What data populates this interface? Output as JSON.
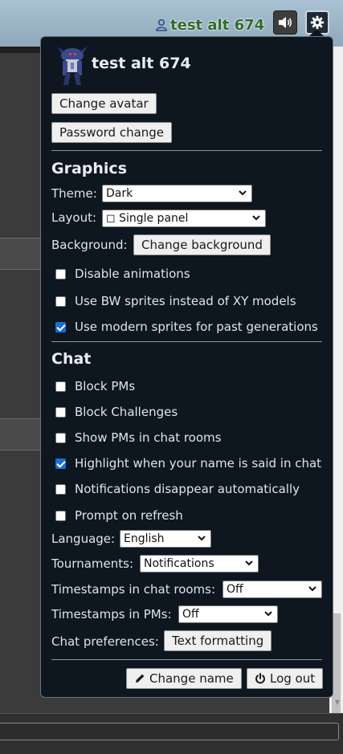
{
  "header": {
    "username": "test alt 674",
    "user_icon": "user-icon",
    "sound_icon": "speaker-volume-icon",
    "settings_icon": "gear-icon"
  },
  "popup": {
    "username": "test alt 674",
    "change_avatar_label": "Change avatar",
    "password_change_label": "Password change",
    "graphics": {
      "heading": "Graphics",
      "theme_label": "Theme:",
      "theme_value": "Dark",
      "layout_label": "Layout:",
      "layout_value": "◻ Single panel",
      "background_label": "Background:",
      "change_background_label": "Change background",
      "options": [
        {
          "label": "Disable animations",
          "checked": false
        },
        {
          "label": "Use BW sprites instead of XY models",
          "checked": false
        },
        {
          "label": "Use modern sprites for past generations",
          "checked": true
        }
      ]
    },
    "chat": {
      "heading": "Chat",
      "options": [
        {
          "label": "Block PMs",
          "checked": false
        },
        {
          "label": "Block Challenges",
          "checked": false
        },
        {
          "label": "Show PMs in chat rooms",
          "checked": false
        },
        {
          "label": "Highlight when your name is said in chat",
          "checked": true
        },
        {
          "label": "Notifications disappear automatically",
          "checked": false
        },
        {
          "label": "Prompt on refresh",
          "checked": false
        }
      ],
      "language_label": "Language:",
      "language_value": "English",
      "tournaments_label": "Tournaments:",
      "tournaments_value": "Notifications",
      "timestamps_rooms_label": "Timestamps in chat rooms:",
      "timestamps_rooms_value": "Off",
      "timestamps_pms_label": "Timestamps in PMs:",
      "timestamps_pms_value": "Off",
      "chat_prefs_label": "Chat preferences:",
      "text_formatting_label": "Text formatting"
    },
    "change_name_label": "Change name",
    "change_name_icon": "pencil-icon",
    "logout_label": "Log out",
    "logout_icon": "power-icon"
  }
}
